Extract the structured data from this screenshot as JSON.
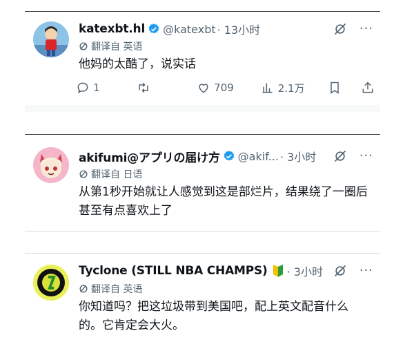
{
  "tweets": [
    {
      "name": "katexbt.hl",
      "handle": "@katexbt",
      "time": "· 13小时",
      "translated_label": "翻译自 英语",
      "text": "他妈的太酷了，说实话",
      "replies": "1",
      "likes": "709",
      "views": "2.1万"
    },
    {
      "name": "akifumi@アプリの届け方",
      "handle": "@akif...",
      "time": "· 3小时",
      "translated_label": "翻译自 日语",
      "text": "从第1秒开始就让人感觉到这是部烂片，结果绕了一圈后甚至有点喜欢上了"
    },
    {
      "name": "Tyclone (STILL NBA CHAMPS)",
      "handle": "",
      "time": "· 3小时",
      "translated_label": "翻译自 英语",
      "text": "你知道吗？把这垃圾带到美国吧，配上英文配音什么的。它肯定会大火。"
    }
  ],
  "colors": {
    "verified": "#1d9bf0",
    "muted": "#536471",
    "text": "#0f1419"
  },
  "icons": [
    "verified-badge-icon",
    "grok-icon",
    "more-icon",
    "translate-icon",
    "reply-icon",
    "retweet-icon",
    "like-icon",
    "views-icon",
    "bookmark-icon",
    "share-icon",
    "beginner-badge-icon"
  ]
}
